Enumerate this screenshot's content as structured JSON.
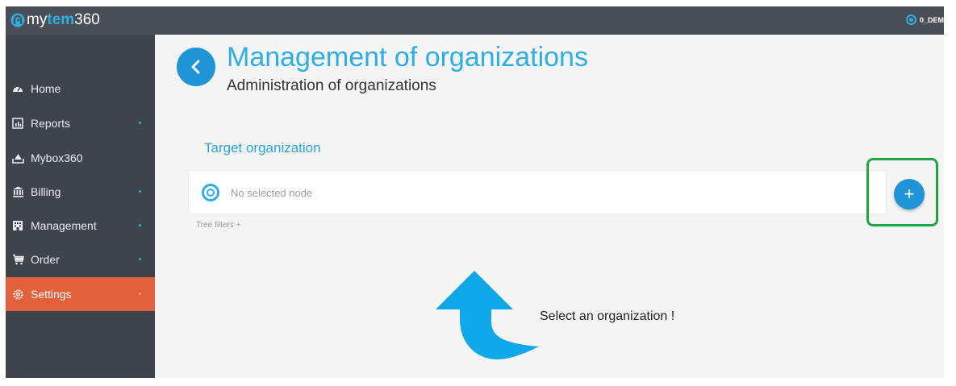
{
  "app": {
    "logo_prefix": "my",
    "logo_mid": "tem",
    "logo_suffix": "360",
    "user_label": "0_DEM"
  },
  "sidebar": {
    "items": [
      {
        "label": "Home",
        "icon": "dashboard-icon",
        "has_dot": false,
        "active": false
      },
      {
        "label": "Reports",
        "icon": "report-icon",
        "has_dot": true,
        "active": false
      },
      {
        "label": "Mybox360",
        "icon": "upload-tray-icon",
        "has_dot": false,
        "active": false
      },
      {
        "label": "Billing",
        "icon": "bank-icon",
        "has_dot": true,
        "active": false
      },
      {
        "label": "Management",
        "icon": "building-icon",
        "has_dot": true,
        "active": false
      },
      {
        "label": "Order",
        "icon": "cart-icon",
        "has_dot": true,
        "active": false
      },
      {
        "label": "Settings",
        "icon": "gear-icon",
        "has_dot": true,
        "active": true
      }
    ]
  },
  "header": {
    "title": "Management of organizations",
    "subtitle": "Administration of organizations"
  },
  "main": {
    "section_label": "Target organization",
    "node_placeholder": "No selected node",
    "tree_filters": "Tree filters +",
    "add_button": "+",
    "hint": "Select an organization !"
  },
  "colors": {
    "accent": "#2eaee6",
    "active_nav": "#e2603a",
    "highlight": "#22a645",
    "sidebar_bg": "#3f444c"
  }
}
